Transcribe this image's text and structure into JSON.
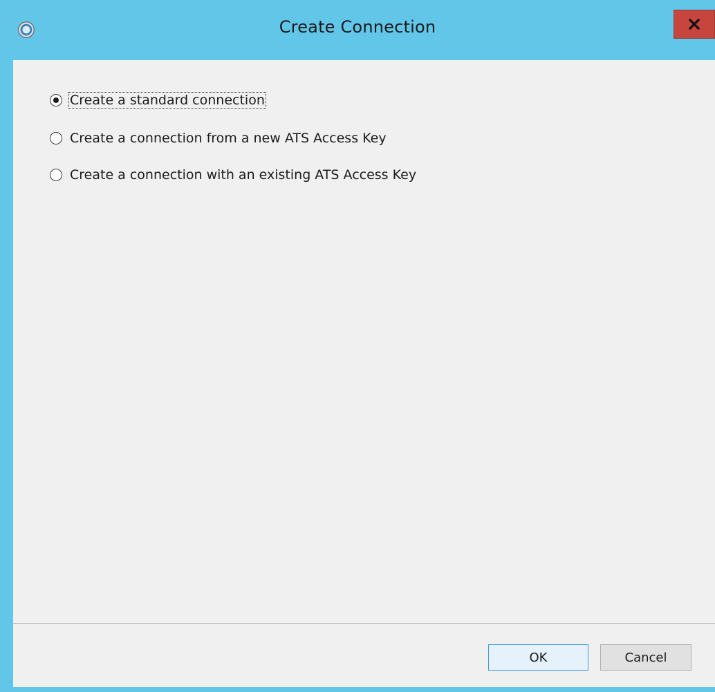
{
  "window": {
    "title": "Create Connection",
    "accent_color": "#62c6e9",
    "close_color": "#c6463e",
    "close_icon": "close-icon",
    "app_icon": "app-icon"
  },
  "options": [
    {
      "label": "Create a standard connection",
      "selected": true
    },
    {
      "label": "Create a connection from a new ATS Access Key",
      "selected": false
    },
    {
      "label": "Create a connection with an existing ATS Access Key",
      "selected": false
    }
  ],
  "buttons": {
    "ok_label": "OK",
    "cancel_label": "Cancel"
  }
}
